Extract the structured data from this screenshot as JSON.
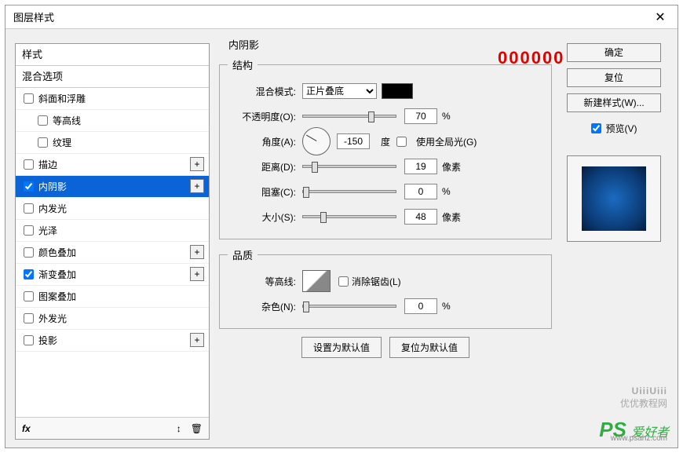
{
  "window": {
    "title": "图层样式",
    "close": "✕"
  },
  "styles": {
    "header": "样式",
    "blending": "混合选项",
    "items": [
      {
        "label": "斜面和浮雕",
        "checked": false,
        "indent": false,
        "plus": false
      },
      {
        "label": "等高线",
        "checked": false,
        "indent": true,
        "plus": false
      },
      {
        "label": "纹理",
        "checked": false,
        "indent": true,
        "plus": false
      },
      {
        "label": "描边",
        "checked": false,
        "indent": false,
        "plus": true
      },
      {
        "label": "内阴影",
        "checked": true,
        "indent": false,
        "plus": true,
        "selected": true
      },
      {
        "label": "内发光",
        "checked": false,
        "indent": false,
        "plus": false
      },
      {
        "label": "光泽",
        "checked": false,
        "indent": false,
        "plus": false
      },
      {
        "label": "颜色叠加",
        "checked": false,
        "indent": false,
        "plus": true
      },
      {
        "label": "渐变叠加",
        "checked": true,
        "indent": false,
        "plus": true
      },
      {
        "label": "图案叠加",
        "checked": false,
        "indent": false,
        "plus": false
      },
      {
        "label": "外发光",
        "checked": false,
        "indent": false,
        "plus": false
      },
      {
        "label": "投影",
        "checked": false,
        "indent": false,
        "plus": true
      }
    ],
    "footer": {
      "fx": "fx",
      "updown": "↕",
      "trash": "🗑"
    }
  },
  "panel": {
    "title": "内阴影",
    "structure": {
      "legend": "结构",
      "blend_label": "混合模式:",
      "blend_value": "正片叠底",
      "color": "#000000",
      "opacity_label": "不透明度(O):",
      "opacity_value": "70",
      "opacity_unit": "%",
      "angle_label": "角度(A):",
      "angle_value": "-150",
      "angle_unit": "度",
      "global_label": "使用全局光(G)",
      "global_checked": false,
      "distance_label": "距离(D):",
      "distance_value": "19",
      "distance_unit": "像素",
      "choke_label": "阻塞(C):",
      "choke_value": "0",
      "choke_unit": "%",
      "size_label": "大小(S):",
      "size_value": "48",
      "size_unit": "像素"
    },
    "quality": {
      "legend": "品质",
      "contour_label": "等高线:",
      "aa_label": "消除锯齿(L)",
      "aa_checked": false,
      "noise_label": "杂色(N):",
      "noise_value": "0",
      "noise_unit": "%"
    },
    "defaults": {
      "set": "设置为默认值",
      "reset": "复位为默认值"
    }
  },
  "right": {
    "ok": "确定",
    "cancel": "复位",
    "newstyle": "新建样式(W)...",
    "preview": "预览(V)",
    "preview_checked": true
  },
  "annotation": "000000",
  "watermark1": {
    "brand": "UiiiUiii",
    "sub": "优优教程网"
  },
  "watermark2": {
    "ps": "PS",
    "txt": "爱好者",
    "url": "www.psahz.com"
  }
}
